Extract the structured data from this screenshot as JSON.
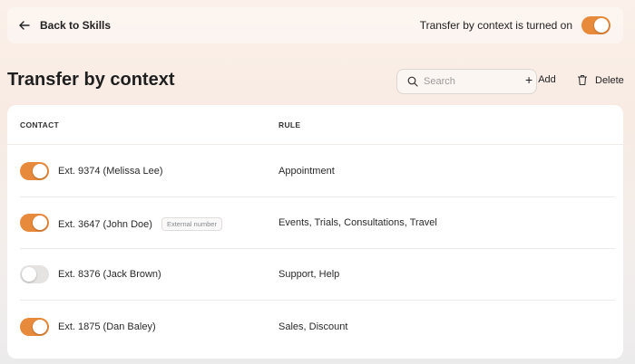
{
  "colors": {
    "accent": "#e88a3c",
    "toggle_off": "#e6e4e3"
  },
  "topbar": {
    "back_label": "Back to Skills",
    "back_icon": "arrow-left-icon",
    "status_text": "Transfer by context is turned on",
    "status_on": true
  },
  "header": {
    "title": "Transfer by context",
    "search_placeholder": "Search",
    "add_label": "Add",
    "delete_label": "Delete"
  },
  "table": {
    "columns": [
      "CONTACT",
      "RULE"
    ],
    "rows": [
      {
        "enabled": true,
        "contact": "Ext. 9374 (Melissa Lee)",
        "badge": "",
        "rule": "Appointment"
      },
      {
        "enabled": true,
        "contact": "Ext. 3647 (John Doe)",
        "badge": "External number",
        "rule": "Events, Trials, Consultations, Travel"
      },
      {
        "enabled": false,
        "contact": "Ext. 8376 (Jack Brown)",
        "badge": "",
        "rule": "Support, Help"
      },
      {
        "enabled": true,
        "contact": "Ext. 1875 (Dan Baley)",
        "badge": "",
        "rule": "Sales, Discount"
      }
    ]
  }
}
